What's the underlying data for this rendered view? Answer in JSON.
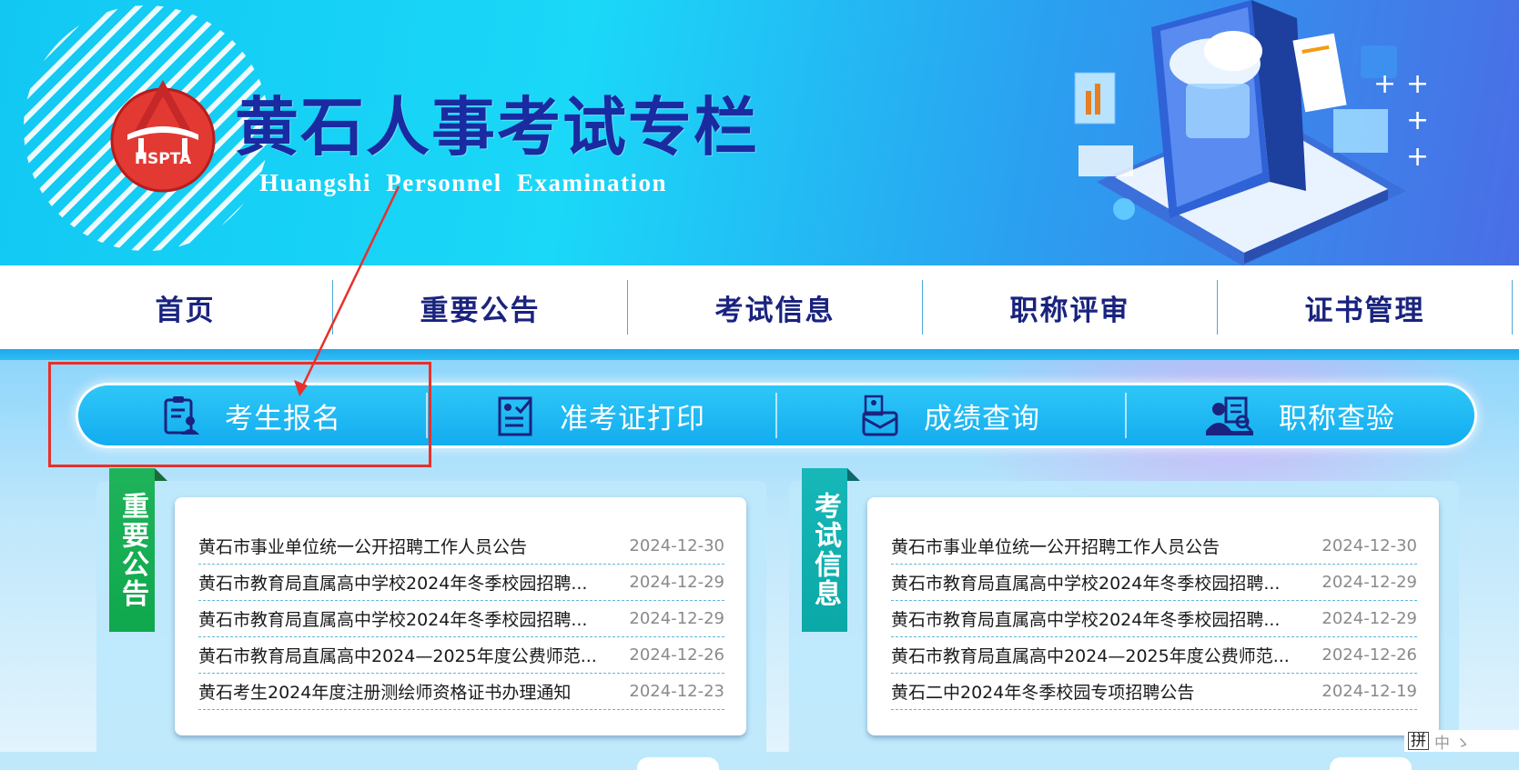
{
  "banner": {
    "title": "黄石人事考试专栏",
    "subtitle": "Huangshi Personnel Examination",
    "logo_text": "HSPTA"
  },
  "main_nav": {
    "items": [
      {
        "label": "首页"
      },
      {
        "label": "重要公告"
      },
      {
        "label": "考试信息"
      },
      {
        "label": "职称评审"
      },
      {
        "label": "证书管理"
      }
    ]
  },
  "quick_links": [
    {
      "label": "考生报名",
      "icon": "clipboard-person-icon"
    },
    {
      "label": "准考证打印",
      "icon": "checklist-icon"
    },
    {
      "label": "成绩查询",
      "icon": "briefcase-icon"
    },
    {
      "label": "职称查验",
      "icon": "person-search-icon"
    }
  ],
  "panels": {
    "announcements": {
      "heading": "重要公告",
      "items": [
        {
          "title": "黄石市事业单位统一公开招聘工作人员公告",
          "date": "2024-12-30"
        },
        {
          "title": "黄石市教育局直属高中学校2024年冬季校园招聘...",
          "date": "2024-12-29"
        },
        {
          "title": "黄石市教育局直属高中学校2024年冬季校园招聘...",
          "date": "2024-12-29"
        },
        {
          "title": "黄石市教育局直属高中2024—2025年度公费师范...",
          "date": "2024-12-26"
        },
        {
          "title": "黄石考生2024年度注册测绘师资格证书办理通知",
          "date": "2024-12-23"
        }
      ]
    },
    "exam_info": {
      "heading": "考试信息",
      "items": [
        {
          "title": "黄石市事业单位统一公开招聘工作人员公告",
          "date": "2024-12-30"
        },
        {
          "title": "黄石市教育局直属高中学校2024年冬季校园招聘...",
          "date": "2024-12-29"
        },
        {
          "title": "黄石市教育局直属高中学校2024年冬季校园招聘...",
          "date": "2024-12-29"
        },
        {
          "title": "黄石市教育局直属高中2024—2025年度公费师范...",
          "date": "2024-12-26"
        },
        {
          "title": "黄石二中2024年冬季校园专项招聘公告",
          "date": "2024-12-19"
        }
      ]
    }
  },
  "ime": {
    "mode": "拼",
    "extra": "中 ⁠ゝ ⁠⁠"
  },
  "colors": {
    "nav_text": "#1a237e",
    "accent_blue": "#13acef",
    "highlight_red": "#e8302a",
    "ribbon_green": "#0fa84d",
    "ribbon_teal": "#0aa8a6"
  }
}
